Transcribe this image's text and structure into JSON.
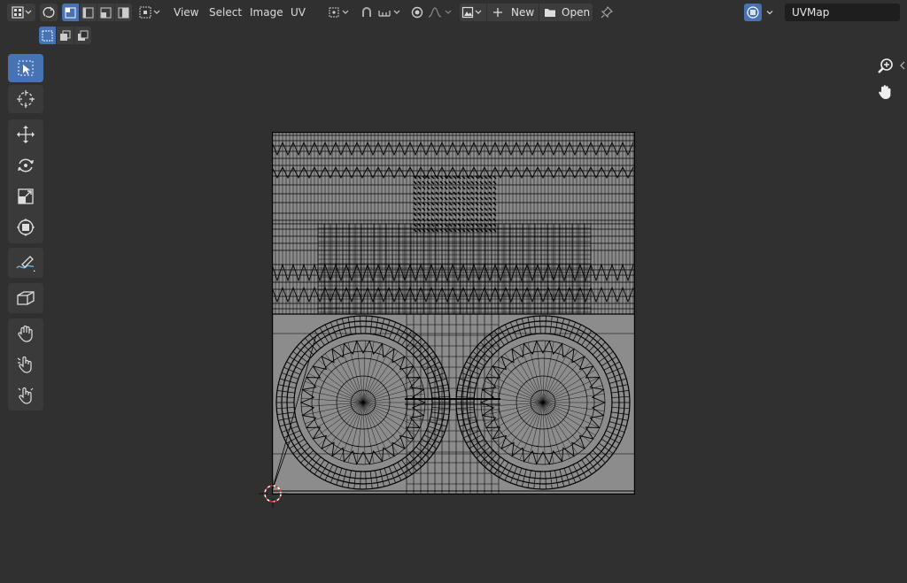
{
  "header": {
    "menu": [
      "View",
      "Select",
      "Image",
      "UV"
    ],
    "new_label": "New",
    "open_label": "Open",
    "uvmap_value": "UVMap"
  },
  "colors": {
    "background": "#303030",
    "header_button": "#3d3d3d",
    "active_accent": "#4772b3",
    "toolbar_bg": "#3a3a3a",
    "uv_fill": "#8c8c8c",
    "cursor_red": "#e03030"
  },
  "toolbar": {
    "tools": [
      "select-box-icon",
      "cursor-icon",
      "move-icon",
      "rotate-icon",
      "scale-icon",
      "transform-icon",
      "annotate-icon",
      "rip-region-icon",
      "grab-icon",
      "relax-icon",
      "pinch-icon"
    ]
  },
  "icons": {
    "editor_type": "uv-editor-icon",
    "sync": "sync-selection-icon",
    "select_modes": [
      "vertex-select-icon",
      "edge-select-icon",
      "face-select-icon",
      "island-select-icon"
    ],
    "pivot": "pivot-point-icon",
    "snap": "snap-icon",
    "proportional": "proportional-edit-icon",
    "falloff": "falloff-icon",
    "image_browse": "image-browse-icon",
    "pin": "pin-icon",
    "uv_layer": "uv-layer-icon",
    "zoom": "zoom-icon",
    "pan": "hand-icon"
  }
}
